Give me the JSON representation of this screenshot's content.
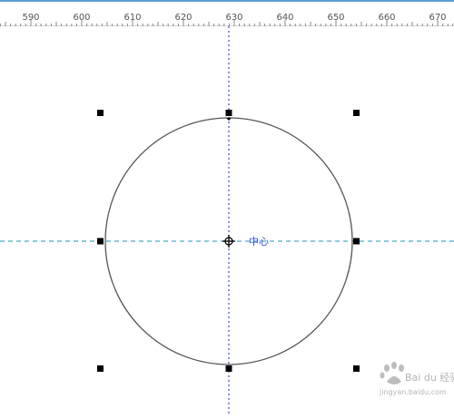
{
  "ruler": {
    "labels": [
      "590",
      "600",
      "610",
      "620",
      "630",
      "640",
      "650",
      "660",
      "670"
    ]
  },
  "canvas": {
    "center_label": "中心",
    "shape": "circle",
    "guide_vertical_color": "#3a4fc9",
    "guide_horizontal_color": "#4aa9c9",
    "handle_color": "#000000"
  },
  "watermark": {
    "brand_text": "Bai du 经验",
    "url_text": "jingyan.baidu.com"
  }
}
